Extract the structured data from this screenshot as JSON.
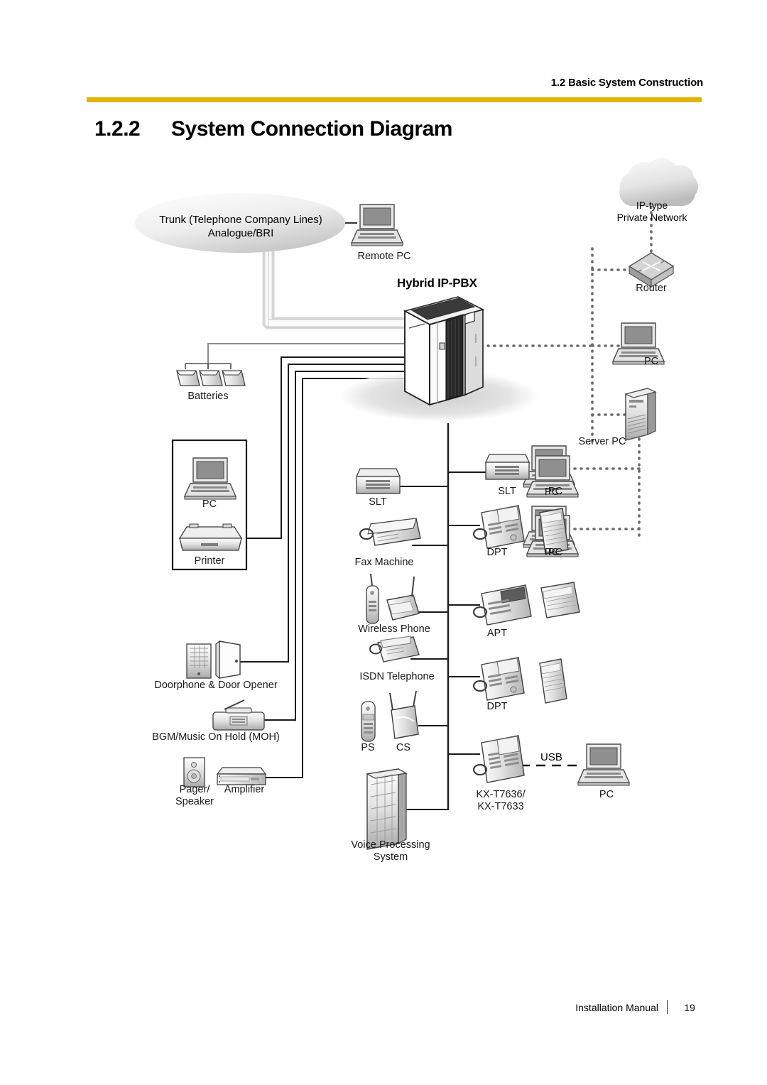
{
  "page": {
    "running_head": "1.2 Basic System Construction",
    "section_number": "1.2.2",
    "section_title": "System Connection Diagram",
    "footer_manual": "Installation Manual",
    "footer_page": "19",
    "rule_color": "#e0b400"
  },
  "diagram": {
    "title": "System Connection Diagram",
    "pbx_label": "Hybrid IP-PBX",
    "usb_label": "USB",
    "trunk_cloud": "Trunk (Telephone Company Lines)\nAnalogue/BRI",
    "network_cloud": "IP-type\nPrivate Network",
    "nodes": [
      {
        "id": "remote-pc",
        "label": "Remote PC"
      },
      {
        "id": "router",
        "label": "Router"
      },
      {
        "id": "pc-router",
        "label": "PC"
      },
      {
        "id": "server-pc",
        "label": "Server PC"
      },
      {
        "id": "pc-lan-1",
        "label": "PC"
      },
      {
        "id": "pc-lan-2",
        "label": "PC"
      },
      {
        "id": "batteries",
        "label": "Batteries"
      },
      {
        "id": "pc-boxed",
        "label": "PC"
      },
      {
        "id": "printer",
        "label": "Printer"
      },
      {
        "id": "doorphone",
        "label": "Doorphone & Door Opener"
      },
      {
        "id": "bgm",
        "label": "BGM/Music On Hold (MOH)"
      },
      {
        "id": "pager",
        "label": "Pager/\nSpeaker"
      },
      {
        "id": "amplifier",
        "label": "Amplifier"
      },
      {
        "id": "slt-left",
        "label": "SLT"
      },
      {
        "id": "fax",
        "label": "Fax Machine"
      },
      {
        "id": "wireless",
        "label": "Wireless Phone"
      },
      {
        "id": "isdn",
        "label": "ISDN Telephone"
      },
      {
        "id": "ps",
        "label": "PS"
      },
      {
        "id": "cs",
        "label": "CS"
      },
      {
        "id": "vps",
        "label": "Voice Processing\nSystem"
      },
      {
        "id": "slt-right",
        "label": "SLT"
      },
      {
        "id": "pc-slt",
        "label": "PC"
      },
      {
        "id": "dpt-upper",
        "label": "DPT"
      },
      {
        "id": "pc-dpt",
        "label": "PC"
      },
      {
        "id": "apt",
        "label": "APT"
      },
      {
        "id": "dpt-lower",
        "label": "DPT"
      },
      {
        "id": "kxt",
        "label": "KX-T7636/\nKX-T7633"
      },
      {
        "id": "pc-usb",
        "label": "PC"
      }
    ]
  }
}
